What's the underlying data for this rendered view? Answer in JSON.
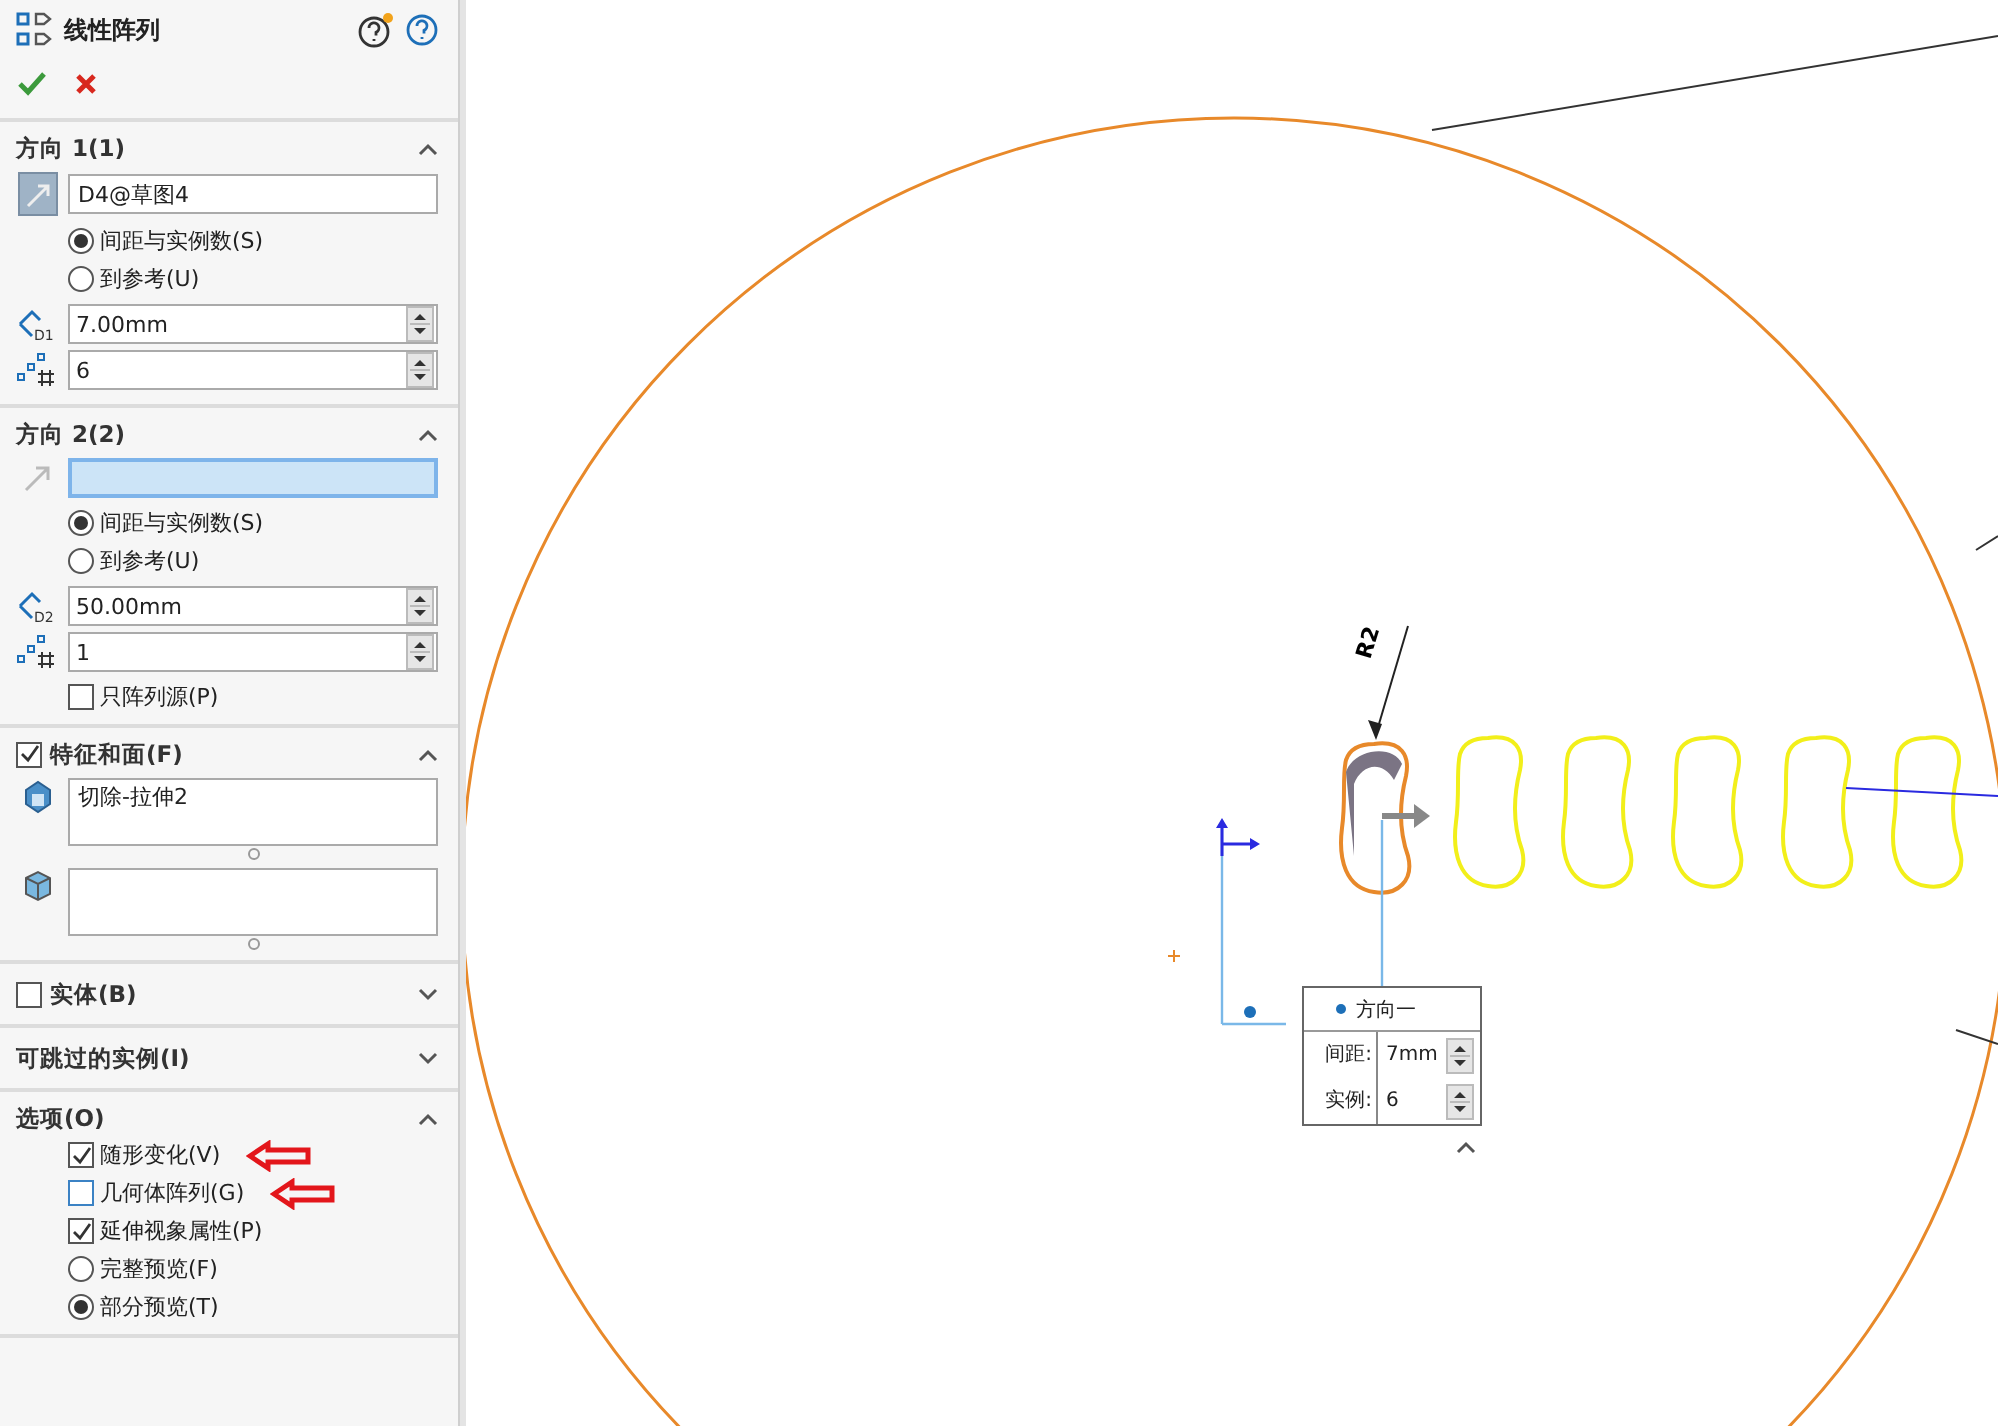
{
  "panel": {
    "title": "线性阵列",
    "sections": [
      {
        "kind": "direction",
        "title": "方向 1(1)",
        "expanded": true,
        "selection": {
          "value": "D4@草图4",
          "active": false
        },
        "options": [
          {
            "label": "间距与实例数(S)",
            "selected": true
          },
          {
            "label": "到参考(U)",
            "selected": false
          }
        ],
        "badge": "D1",
        "spacing": "7.00mm",
        "count": "6"
      },
      {
        "kind": "direction",
        "title": "方向 2(2)",
        "expanded": true,
        "selection": {
          "active": true
        },
        "options": [
          {
            "label": "间距与实例数(S)",
            "selected": true
          },
          {
            "label": "到参考(U)",
            "selected": false
          }
        ],
        "badge": "D2",
        "spacing": "50.00mm",
        "count": "1",
        "checkbox": {
          "label": "只阵列源(P)",
          "checked": false
        }
      },
      {
        "kind": "features",
        "title": "特征和面(F)",
        "checked": true,
        "expanded": true,
        "lists": [
          {
            "kind": "feature",
            "items": [
              "切除-拉伸2"
            ]
          },
          {
            "kind": "face"
          }
        ]
      },
      {
        "kind": "plain",
        "title": "实体(B)",
        "checked": false,
        "expanded": false
      },
      {
        "kind": "plain",
        "title": "可跳过的实例(I)",
        "expanded": false
      },
      {
        "kind": "options",
        "title": "选项(O)",
        "expanded": true,
        "checkboxes": [
          {
            "label": "随形变化(V)",
            "checked": true,
            "highlighted": true
          },
          {
            "label": "几何体阵列(G)",
            "checked": false,
            "highlighted": true
          },
          {
            "label": "延伸视象属性(P)",
            "checked": true,
            "highlighted": false
          }
        ],
        "options": [
          {
            "label": "完整预览(F)",
            "selected": false
          },
          {
            "label": "部分预览(T)",
            "selected": true
          }
        ]
      }
    ]
  },
  "canvas": {
    "dimension": "R2",
    "callout": {
      "title": "方向一",
      "rows": [
        {
          "label": "间距:",
          "value": "7mm"
        },
        {
          "label": "实例:",
          "value": "6"
        }
      ]
    }
  }
}
